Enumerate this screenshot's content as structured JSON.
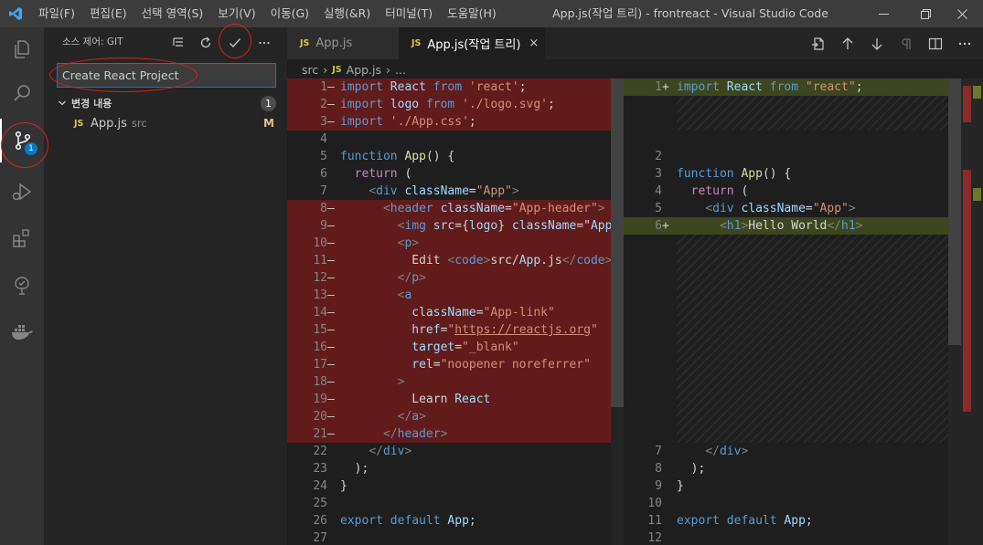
{
  "title_bar": {
    "menu": [
      "파일(F)",
      "편집(E)",
      "선택 영역(S)",
      "보기(V)",
      "이동(G)",
      "실행(&R)",
      "터미널(T)",
      "도움말(H)"
    ],
    "window_title": "App.js(작업 트리) - frontreact - Visual Studio Code"
  },
  "activity_bar": {
    "items": [
      "files-icon",
      "search-icon",
      "source-control-icon",
      "run-debug-icon",
      "extensions-icon",
      "remote-explorer-icon",
      "docker-icon"
    ],
    "scm_badge": "1"
  },
  "sidebar": {
    "title": "소스 제어: GIT",
    "commit_message": "Create React Project",
    "changes_label": "변경 내용",
    "changes_count": "1",
    "files": [
      {
        "badge": "JS",
        "name": "App.js",
        "path": "src",
        "status": "M"
      }
    ]
  },
  "tabs": [
    {
      "badge": "JS",
      "label": "App.js",
      "active": false
    },
    {
      "badge": "JS",
      "label": "App.js(작업 트리)",
      "active": true,
      "close": "×"
    }
  ],
  "breadcrumb": {
    "folder": "src",
    "badge": "JS",
    "file": "App.js",
    "more": "..."
  },
  "diff_left": {
    "lines": [
      {
        "n": "1",
        "m": "—",
        "text": "import React from 'react';"
      },
      {
        "n": "2",
        "m": "—",
        "text": "import logo from './logo.svg';"
      },
      {
        "n": "3",
        "m": "—",
        "text": "import './App.css';"
      },
      {
        "n": "4",
        "m": "",
        "text": ""
      },
      {
        "n": "5",
        "m": "",
        "text": "function App() {"
      },
      {
        "n": "6",
        "m": "",
        "text": "  return ("
      },
      {
        "n": "7",
        "m": "",
        "text": "    <div className=\"App\">"
      },
      {
        "n": "8",
        "m": "—",
        "text": "      <header className=\"App-header\">"
      },
      {
        "n": "9",
        "m": "—",
        "text": "        <img src={logo} className=\"App-lo"
      },
      {
        "n": "10",
        "m": "—",
        "text": "        <p>"
      },
      {
        "n": "11",
        "m": "—",
        "text": "          Edit <code>src/App.js</code> an"
      },
      {
        "n": "12",
        "m": "—",
        "text": "        </p>"
      },
      {
        "n": "13",
        "m": "—",
        "text": "        <a"
      },
      {
        "n": "14",
        "m": "—",
        "text": "          className=\"App-link\""
      },
      {
        "n": "15",
        "m": "—",
        "text": "          href=\"https://reactjs.org\""
      },
      {
        "n": "16",
        "m": "—",
        "text": "          target=\"_blank\""
      },
      {
        "n": "17",
        "m": "—",
        "text": "          rel=\"noopener noreferrer\""
      },
      {
        "n": "18",
        "m": "—",
        "text": "        >"
      },
      {
        "n": "19",
        "m": "—",
        "text": "          Learn React"
      },
      {
        "n": "20",
        "m": "—",
        "text": "        </a>"
      },
      {
        "n": "21",
        "m": "—",
        "text": "      </header>"
      },
      {
        "n": "22",
        "m": "",
        "text": "    </div>"
      },
      {
        "n": "23",
        "m": "",
        "text": "  );"
      },
      {
        "n": "24",
        "m": "",
        "text": "}"
      },
      {
        "n": "25",
        "m": "",
        "text": ""
      },
      {
        "n": "26",
        "m": "",
        "text": "export default App;"
      },
      {
        "n": "27",
        "m": "",
        "text": ""
      }
    ]
  },
  "diff_right": {
    "lines": [
      {
        "n": "1",
        "m": "+",
        "text": "import React from \"react\";"
      },
      {
        "n": "2",
        "m": "",
        "text": ""
      },
      {
        "n": "3",
        "m": "",
        "text": "function App() {"
      },
      {
        "n": "4",
        "m": "",
        "text": "  return ("
      },
      {
        "n": "5",
        "m": "",
        "text": "    <div className=\"App\">"
      },
      {
        "n": "6",
        "m": "+",
        "text": "      <h1>Hello World</h1>"
      },
      {
        "n": "7",
        "m": "",
        "text": "    </div>"
      },
      {
        "n": "8",
        "m": "",
        "text": "  );"
      },
      {
        "n": "9",
        "m": "",
        "text": "}"
      },
      {
        "n": "10",
        "m": "",
        "text": ""
      },
      {
        "n": "11",
        "m": "",
        "text": "export default App;"
      },
      {
        "n": "12",
        "m": "",
        "text": ""
      }
    ]
  }
}
